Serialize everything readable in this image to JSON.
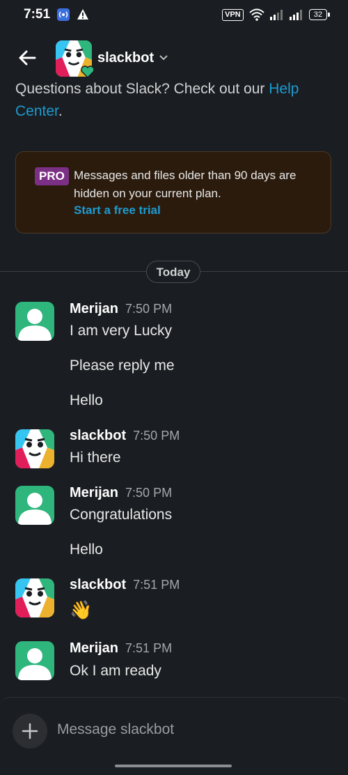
{
  "status_bar": {
    "time": "7:51",
    "vpn": "VPN",
    "battery": "32"
  },
  "header": {
    "title": "slackbot"
  },
  "intro": {
    "text": "Questions about Slack? Check out our ",
    "link": "Help Center",
    "suffix": "."
  },
  "banner": {
    "badge": "PRO",
    "text": "Messages and files older than 90 days are hidden on your current plan.",
    "link": "Start a free trial"
  },
  "divider": {
    "label": "Today"
  },
  "messages": [
    {
      "sender": "Merijan",
      "time": "7:50 PM",
      "lines": [
        "I am very Lucky",
        "Please reply me",
        "Hello"
      ]
    },
    {
      "sender": "slackbot",
      "time": "7:50 PM",
      "lines": [
        "Hi there"
      ]
    },
    {
      "sender": "Merijan",
      "time": "7:50 PM",
      "lines": [
        "Congratulations",
        "Hello"
      ]
    },
    {
      "sender": "slackbot",
      "time": "7:51 PM",
      "lines": [
        "👋"
      ]
    },
    {
      "sender": "Merijan",
      "time": "7:51 PM",
      "lines": [
        "Ok I am ready"
      ]
    }
  ],
  "composer": {
    "placeholder": "Message slackbot"
  },
  "colors": {
    "background": "#1a1d21",
    "link": "#1d9bd1",
    "pro": "#7c3085",
    "user_avatar": "#2eb67d"
  }
}
